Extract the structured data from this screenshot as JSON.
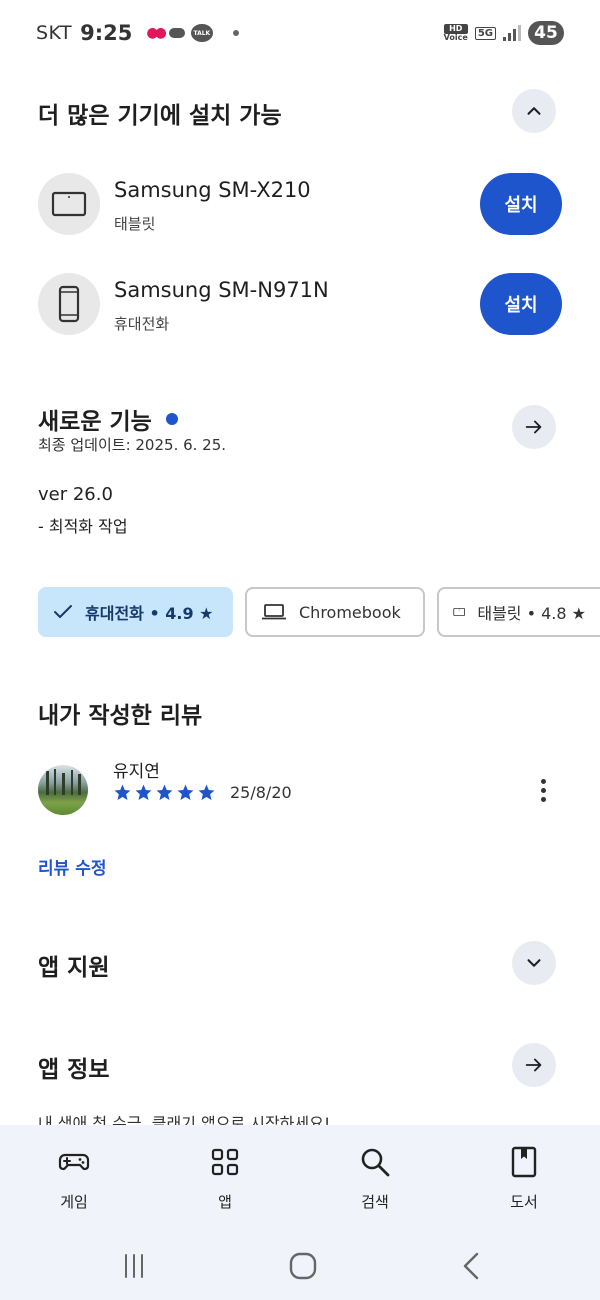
{
  "status_bar": {
    "carrier": "SKT",
    "time": "9:25",
    "talk_label": "TALK",
    "hd_label": "HD",
    "voice_label": "Voice",
    "network": "5G",
    "battery": "45"
  },
  "more_devices": {
    "title": "더 많은 기기에 설치 가능",
    "devices": [
      {
        "name": "Samsung SM-X210",
        "type": "태블릿",
        "button": "설치"
      },
      {
        "name": "Samsung SM-N971N",
        "type": "휴대전화",
        "button": "설치"
      }
    ]
  },
  "whats_new": {
    "title": "새로운 기능",
    "updated": "최종 업데이트: 2025. 6. 25.",
    "version": "ver 26.0",
    "note": "- 최적화 작업",
    "dot_color": "#1f55cc"
  },
  "chips": [
    {
      "label": "휴대전화 • 4.9 ★",
      "selected": true
    },
    {
      "label": "Chromebook",
      "selected": false
    },
    {
      "label": "태블릿 • 4.8 ★",
      "selected": false
    }
  ],
  "my_review": {
    "title": "내가 작성한 리뷰",
    "reviewer": "유지연",
    "rating": 5,
    "date": "25/8/20",
    "edit_label": "리뷰 수정",
    "star_color": "#1f55cc"
  },
  "app_support": {
    "title": "앱 지원"
  },
  "app_info": {
    "title": "앱 정보",
    "description": "내 생애 첫 수금, 클래기 앱으로 시작하세요!"
  },
  "bottom_nav": [
    {
      "label": "게임",
      "icon": "gamepad-icon"
    },
    {
      "label": "앱",
      "icon": "apps-grid-icon"
    },
    {
      "label": "검색",
      "icon": "search-icon"
    },
    {
      "label": "도서",
      "icon": "book-icon"
    }
  ],
  "colors": {
    "accent": "#1f55cc",
    "chip_selected_bg": "#c8e6fb",
    "nav_bg": "#f0f3f9"
  }
}
